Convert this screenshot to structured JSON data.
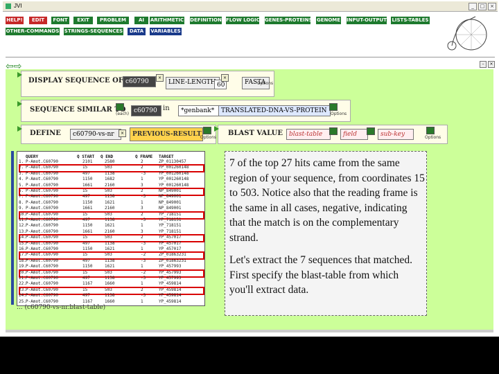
{
  "window": {
    "title": "JVI"
  },
  "menu": [
    {
      "label": "HELP!",
      "color": "red"
    },
    {
      "label": "EDIT",
      "color": "red"
    },
    {
      "label": "FONT",
      "color": "green"
    },
    {
      "label": "EXIT",
      "color": "green"
    },
    {
      "label": "PROBLEM",
      "color": "green"
    },
    {
      "label": "AI",
      "color": "green"
    },
    {
      "label": "ARITHMETIC",
      "color": "green"
    },
    {
      "label": "DEFINITION",
      "color": "green"
    },
    {
      "label": "FLOW LOGIC",
      "color": "green"
    },
    {
      "label": "GENES-PROTEINS",
      "color": "green"
    },
    {
      "label": "GENOME",
      "color": "green"
    },
    {
      "label": "INPUT-OUTPUT",
      "color": "green"
    },
    {
      "label": "LISTS-TABLES",
      "color": "green"
    },
    {
      "label": "OTHER-COMMANDS",
      "color": "green"
    },
    {
      "label": "STRINGS-SEQUENCES",
      "color": "green"
    },
    {
      "label": "DATA",
      "color": "blue"
    },
    {
      "label": "VARIABLES",
      "color": "blue"
    }
  ],
  "nav": {
    "back": "⇦",
    "forward": "⇨"
  },
  "workspace": {
    "block1": {
      "label": "DISPLAY SEQUENCE OF",
      "arg": "c60790",
      "option1": "LINE-LENGTH",
      "value1": "60",
      "option2": "FASTA",
      "options": "Options"
    },
    "block2": {
      "label": "SEQUENCE SIMILAR TO",
      "small1": "(each)",
      "arg": "c60790",
      "in_word": "in",
      "db": "*genbank*",
      "program": "TRANSLATED-DNA-VS-PROTEIN",
      "options": "Options"
    },
    "block3": {
      "label": "DEFINE",
      "var": "c60790-vs-nr",
      "as_word": "as",
      "result": "PREVIOUS-RESULT",
      "options": "Options"
    },
    "block4": {
      "label": "BLAST VALUE",
      "field1": "blast-table",
      "field2": "field",
      "field3": "sub-key",
      "options": "Options"
    }
  },
  "table": {
    "headers": [
      "QUERY",
      "Q START",
      "Q END",
      "Q FRAME",
      "TARGET"
    ],
    "rows": [
      {
        "n": "1.",
        "query": "P-Amot.C60790",
        "qs": "2101",
        "qe": "2580",
        "fr": "2",
        "tgt": "ZP_01130457"
      },
      {
        "n": "2.",
        "query": "P-Amot.C60790",
        "qs": "15",
        "qe": "503",
        "fr": "2",
        "tgt": "YP_001260148",
        "hl": true
      },
      {
        "n": "3.",
        "query": "P-Amot.C60790",
        "qs": "497",
        "qe": "1138",
        "fr": "-3",
        "tgt": "YP_001260148"
      },
      {
        "n": "4.",
        "query": "P-Amot.C60790",
        "qs": "1150",
        "qe": "1682",
        "fr": "1",
        "tgt": "YP_001260148"
      },
      {
        "n": "5.",
        "query": "P-Amot.C60790",
        "qs": "1661",
        "qe": "2160",
        "fr": "3",
        "tgt": "YP_001260148"
      },
      {
        "n": "6.",
        "query": "P-Amot.C60790",
        "qs": "15",
        "qe": "503",
        "fr": "2",
        "tgt": "NP_849001",
        "hl": true
      },
      {
        "n": "7.",
        "query": "P-Amot.C60790",
        "qs": "497",
        "qe": "1138",
        "fr": "-3",
        "tgt": "NP_849001"
      },
      {
        "n": "8.",
        "query": "P-Amot.C60790",
        "qs": "1150",
        "qe": "1621",
        "fr": "1",
        "tgt": "NP_849001"
      },
      {
        "n": "9.",
        "query": "P-Amot.C60790",
        "qs": "1661",
        "qe": "2160",
        "fr": "3",
        "tgt": "NP_849001"
      },
      {
        "n": "10.",
        "query": "P-Amot.C60790",
        "qs": "15",
        "qe": "503",
        "fr": "2",
        "tgt": "YP_718151",
        "hl": true
      },
      {
        "n": "11.",
        "query": "P-Amot.C60790",
        "qs": "497",
        "qe": "1138",
        "fr": "-3",
        "tgt": "YP_718151"
      },
      {
        "n": "12.",
        "query": "P-Amot.C60790",
        "qs": "1150",
        "qe": "1621",
        "fr": "1",
        "tgt": "YP_718151"
      },
      {
        "n": "13.",
        "query": "P-Amot.C60790",
        "qs": "1661",
        "qe": "2160",
        "fr": "3",
        "tgt": "YP_718151"
      },
      {
        "n": "14.",
        "query": "P-Amot.C60790",
        "qs": "15",
        "qe": "503",
        "fr": "2",
        "tgt": "YP_457017",
        "hl": true
      },
      {
        "n": "15.",
        "query": "P-Amot.C60790",
        "qs": "497",
        "qe": "1138",
        "fr": "-3",
        "tgt": "YP_457017"
      },
      {
        "n": "16.",
        "query": "P-Amot.C60790",
        "qs": "1150",
        "qe": "1621",
        "fr": "1",
        "tgt": "YP_457017"
      },
      {
        "n": "17.",
        "query": "P-Amot.C60790",
        "qs": "15",
        "qe": "503",
        "fr": "-2",
        "tgt": "ZP_01863231",
        "hl": true
      },
      {
        "n": "18.",
        "query": "P-Amot.C60790",
        "qs": "497",
        "qe": "1138",
        "fr": "-3",
        "tgt": "ZP_01863231"
      },
      {
        "n": "19.",
        "query": "P-Amot.C60790",
        "qs": "1150",
        "qe": "1621",
        "fr": "1",
        "tgt": "YP_457993"
      },
      {
        "n": "20.",
        "query": "P-Amot.C60790",
        "qs": "15",
        "qe": "503",
        "fr": "-2",
        "tgt": "YP_457993",
        "hl": true
      },
      {
        "n": "21.",
        "query": "P-Amot.C60790",
        "qs": "497",
        "qe": "1138",
        "fr": "-3",
        "tgt": "YP_457993"
      },
      {
        "n": "22.",
        "query": "P-Amot.C60790",
        "qs": "1167",
        "qe": "1660",
        "fr": "1",
        "tgt": "YP_459814"
      },
      {
        "n": "23.",
        "query": "P-Amot.C60790",
        "qs": "15",
        "qe": "503",
        "fr": "2",
        "tgt": "YP_459814",
        "hl": true
      },
      {
        "n": "24.",
        "query": "P-Amot.C60790",
        "qs": "497",
        "qe": "1138",
        "fr": "-3",
        "tgt": "YP_459814"
      },
      {
        "n": "25.",
        "query": "P-Amot.C60790",
        "qs": "1167",
        "qe": "1660",
        "fr": "1",
        "tgt": "YP_459814"
      }
    ]
  },
  "ghost_text": "... (c60790-vs-nr.blast-table)",
  "note": {
    "p1": "7 of the top 27 hits came from the same region of your sequence, from coordinates 15 to 503. Notice also that the reading frame is the same in all cases, negative, indicating that the match is on the complementary strand.",
    "p2": "Let's extract the 7 sequences that matched. First specify the blast-table from which you'll extract data."
  }
}
